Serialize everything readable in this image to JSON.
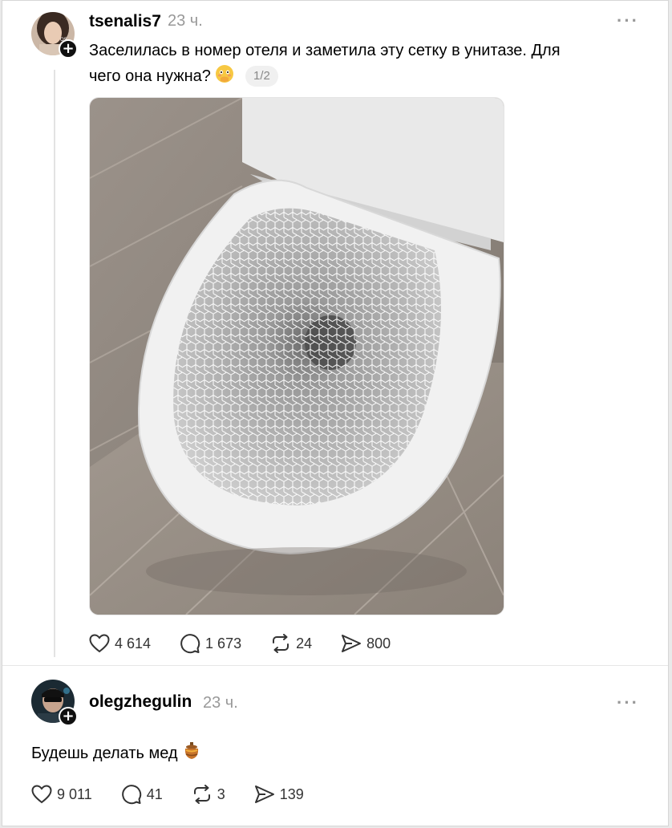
{
  "post": {
    "username": "tsenalis7",
    "time": "23 ч.",
    "more": "···",
    "follow": "+",
    "text_line1": "Заселилась в номер отеля и заметила эту сетку в унитазе. Для",
    "text_line2": "чего она нужна?",
    "emoji_icon": "flushed-face-hand-over-mouth",
    "media_counter": "1/2",
    "likes": "4 614",
    "replies": "1 673",
    "reposts": "24",
    "shares": "800"
  },
  "reply": {
    "username": "olegzhegulin",
    "time": "23 ч.",
    "more": "···",
    "follow": "+",
    "text": "Будешь делать мед",
    "emoji_icon": "honey-pot",
    "likes": "9 011",
    "replies": "41",
    "reposts": "3",
    "shares": "139"
  },
  "colors": {
    "text": "#000000",
    "muted": "#999999",
    "icon": "#333333",
    "background": "#ffffff"
  }
}
